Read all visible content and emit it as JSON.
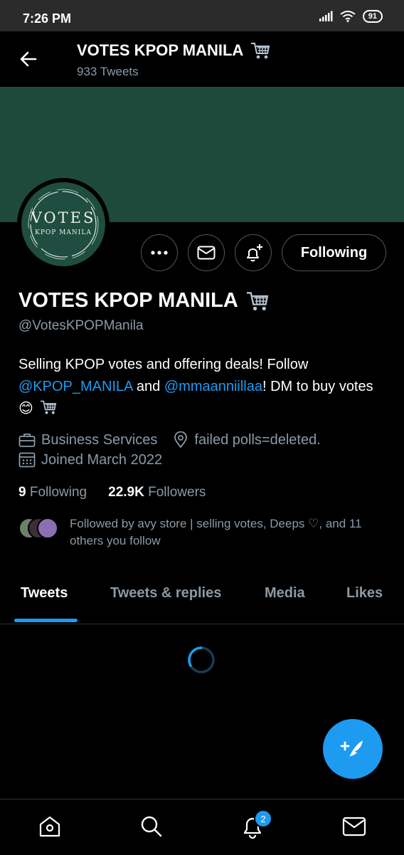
{
  "status_bar": {
    "time": "7:26 PM",
    "battery": "91"
  },
  "header": {
    "title": "VOTES KPOP MANILA",
    "tweet_count": "933 Tweets"
  },
  "avatar": {
    "line1": "VOTES",
    "line2": "KPOP MANILA"
  },
  "actions": {
    "following_label": "Following"
  },
  "profile": {
    "name": "VOTES KPOP MANILA",
    "handle": "@VotesKPOPManila",
    "bio_part1": "Selling KPOP votes and offering deals! Follow ",
    "bio_mention1": "@KPOP_MANILA",
    "bio_part2": " and ",
    "bio_mention2": "@mmaanniillaa",
    "bio_part3": "! DM to buy votes",
    "bio_emoji": "😊",
    "category": "Business Services",
    "location": "failed polls=deleted.",
    "joined": "Joined March 2022",
    "following_count": "9",
    "following_label": "Following",
    "followers_count": "22.9K",
    "followers_label": "Followers",
    "followed_by": "Followed by avy store | selling votes, Deeps ♡, and 11 others you follow"
  },
  "tabs": [
    {
      "label": "Tweets"
    },
    {
      "label": "Tweets & replies"
    },
    {
      "label": "Media"
    },
    {
      "label": "Likes"
    }
  ],
  "bottom_nav": {
    "notification_badge": "2"
  },
  "colors": {
    "accent": "#1d9bf0",
    "banner": "#1e4a3c",
    "muted": "#8b9aa6"
  }
}
